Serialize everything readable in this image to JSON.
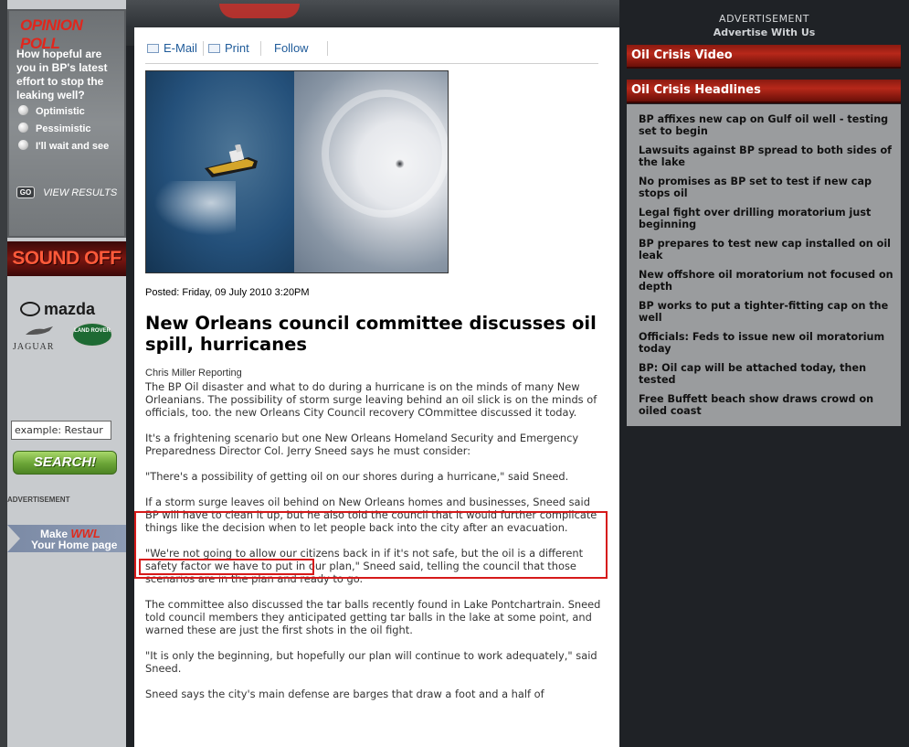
{
  "poll": {
    "title": "OPINION POLL",
    "question": "How hopeful are you in BP's latest effort to stop the leaking well?",
    "options": [
      "Optimistic",
      "Pessimistic",
      "I'll wait and see"
    ],
    "go_label": "GO",
    "view_results": "VIEW RESULTS"
  },
  "sound_off": "SOUND OFF",
  "sponsors": {
    "mazda": "mazda",
    "jaguar": "JAGUAR",
    "land_rover": "LAND ROVER"
  },
  "search": {
    "placeholder": "example: Restaurants",
    "value": "example: Restaur",
    "button": "SEARCH!"
  },
  "left_ad_label": "ADVERTISEMENT",
  "wwl_banner": {
    "make": "Make",
    "brand": "WWL",
    "line2": "Your Home page"
  },
  "toolbar": {
    "email": "E-Mail",
    "print": "Print",
    "follow": "Follow"
  },
  "article": {
    "posted": "Posted: Friday, 09 July 2010 3:20PM",
    "headline": "New Orleans council committee discusses oil spill, hurricanes",
    "byline": "Chris Miller Reporting",
    "paragraphs": [
      "The BP Oil disaster and what to do during a hurricane is on the minds of many New Orleanians. The possibility of storm surge leaving behind an oil slick is on the minds of officials, too. the new Orleans City Council recovery COmmittee discussed it today.",
      "It's a frightening scenario but one New Orleans Homeland Security and Emergency Preparedness Director Col. Jerry Sneed says he must consider:",
      "\"There's a possibility of getting oil on our shores during a hurricane,\" said Sneed.",
      "If a storm surge leaves oil behind on New Orleans homes and businesses, Sneed said BP will have to clean it up, but he also told the council that it would further complicate things like the decision when to let people back into the city after an evacuation.",
      "\"We're not going to allow our citizens back in if it's not safe, but the oil is a different safety factor we have to put in our plan,\" Sneed said, telling the council that those scenarios are in the plan and ready to go.",
      "The committee also discussed the tar balls recently found in Lake Pontchartrain. Sneed told council members they anticipated getting tar balls in the lake at some point, and warned these are just the first shots in the oil fight.",
      "\"It is only the beginning, but hopefully our plan will continue to work adequately,\" said Sneed.",
      "Sneed says the city's main defense are barges that draw a foot and a half of"
    ]
  },
  "right": {
    "ad_label": "ADVERTISEMENT",
    "ad_link": "Advertise With Us",
    "video_title": "Oil Crisis Video",
    "headlines_title": "Oil Crisis Headlines",
    "headlines": [
      "BP affixes new cap on Gulf oil well - testing set to begin",
      "Lawsuits against BP spread to both sides of the lake",
      "No promises as BP set to test if new cap stops oil",
      "Legal fight over drilling moratorium just beginning",
      "BP prepares to test new cap installed on oil leak",
      "New offshore oil moratorium not focused on depth",
      "BP works to put a tighter-fitting cap on the well",
      "Officials: Feds to issue new oil moratorium today",
      "BP: Oil cap will be attached today, then tested",
      "Free Buffett beach show draws crowd on oiled coast"
    ]
  },
  "colors": {
    "poll_title": "#e1261c",
    "section_header": "#b7281a",
    "link": "#1e5a99",
    "annotation_box": "#d61a1a"
  }
}
